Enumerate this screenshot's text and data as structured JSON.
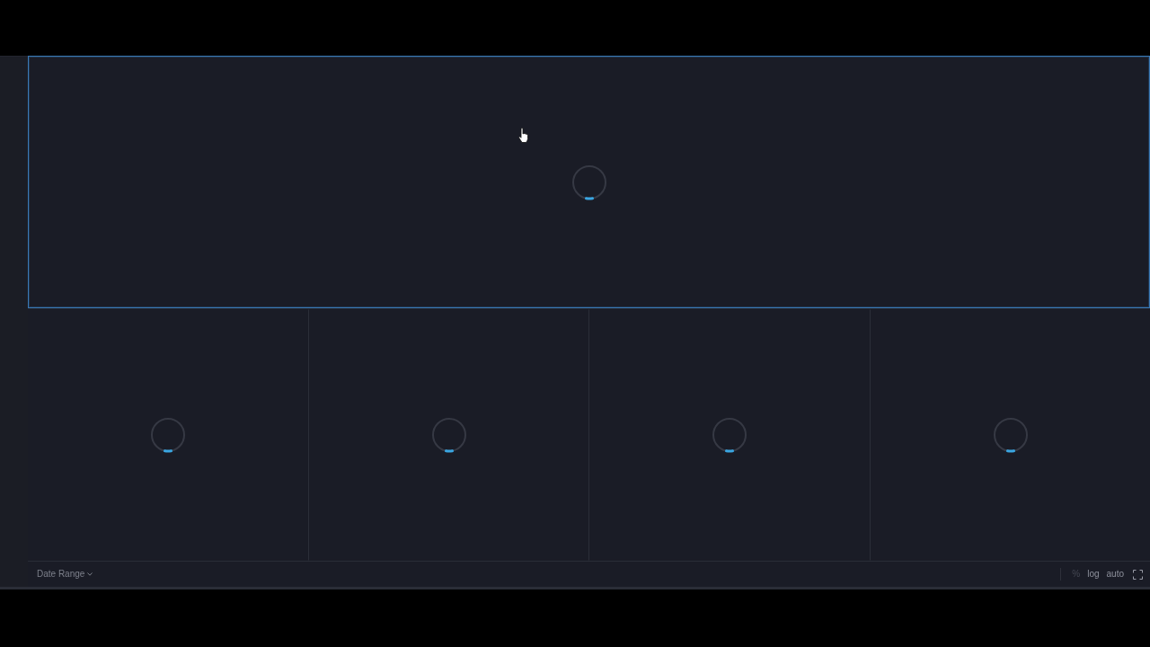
{
  "main_panel": {
    "selected": true,
    "loading": true
  },
  "panels": [
    {
      "selected": false,
      "loading": true
    },
    {
      "selected": false,
      "loading": true
    },
    {
      "selected": false,
      "loading": true
    },
    {
      "selected": false,
      "loading": true
    }
  ],
  "footer": {
    "date_range": {
      "label": "Date Range"
    },
    "toggles": [
      {
        "label": "%",
        "disabled": true
      },
      {
        "label": "log",
        "disabled": false
      },
      {
        "label": "auto",
        "disabled": false
      }
    ]
  }
}
